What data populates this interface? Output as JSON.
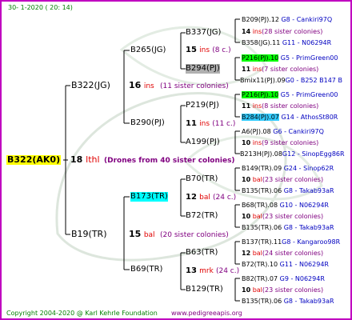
{
  "header": {
    "date_text": "30-   1-2020  ( 20:  14)"
  },
  "footer": {
    "copyright": "Copyright 2004-2020 @ Karl Kehrle Foundation",
    "site": "www.pedigreeapis.org"
  },
  "root": {
    "label": "B322(AK0)",
    "index": "18",
    "ins": "lthl",
    "note": "(Drones from 40 sister colonies)"
  },
  "gen1": [
    {
      "label": "B322(JG)",
      "index": "16",
      "ins": "ins",
      "note": "(11 sister colonies)"
    },
    {
      "label": "B19(TR)",
      "index": "15",
      "ins": "bal",
      "note": "(20 sister colonies)"
    }
  ],
  "gen2": [
    {
      "label": "B265(JG)",
      "index": "15",
      "ins": "ins",
      "note": "(8 c.)"
    },
    {
      "label": "B290(PJ)",
      "index": "13",
      "ins": "ins",
      "note": "(11 c.)"
    },
    {
      "label": "B173(TR)",
      "index": "12",
      "ins": "bal",
      "note": "(24 c.)"
    },
    {
      "label": "B69(TR)",
      "index": "13",
      "ins": "mrk",
      "note": "(24 c.)"
    }
  ],
  "gen3": [
    {
      "label": "B337(JG)",
      "index": "15",
      "ins": "ins",
      "note": "(8 c.)"
    },
    {
      "label": "B294(PJ)"
    },
    {
      "label": "P219(PJ)",
      "index": "11",
      "ins": "ins",
      "note": "(11 c.)"
    },
    {
      "label": "A199(PJ)"
    },
    {
      "label": "B70(TR)",
      "index": "12",
      "ins": "bal",
      "note": "(24 c.)"
    },
    {
      "label": "B72(TR)"
    },
    {
      "label": "B63(TR)",
      "index": "13",
      "ins": "mrk",
      "note": "(24 c.)"
    },
    {
      "label": "B129(TR)"
    }
  ],
  "gen4": [
    {
      "label": "B209(PJ).12",
      "suffix": "G8 - Cankiri97Q"
    },
    {
      "label": "14",
      "ins": "ins",
      "note": "(28 sister colonies)"
    },
    {
      "label": "B358(JG).11",
      "suffix": "G11 - N06294R"
    },
    {
      "label": "P216(PJ).10",
      "suffix": "G5 - PrimGreen00"
    },
    {
      "label": "11",
      "ins": "ins",
      "note": "(7 sister colonies)"
    },
    {
      "label": "Bmix11(PJ).09",
      "suffix": "G0 - B252 B147 B"
    },
    {
      "label": "P216(PJ).10",
      "suffix": "G5 - PrimGreen00"
    },
    {
      "label": "11",
      "ins": "ins",
      "note": "(8 sister colonies)"
    },
    {
      "label": "B284(PJ).07",
      "suffix": "G14 - AthosSt80R"
    },
    {
      "label": "A6(PJ).08",
      "suffix": "G6 - Cankiri97Q"
    },
    {
      "label": "10",
      "ins": "ins",
      "note": "(9 sister colonies)"
    },
    {
      "label": "B213H(PJ).08",
      "suffix": "G12 - SinopEgg86R"
    },
    {
      "label": "B149(TR).09",
      "suffix": "G24 - Sinop62R"
    },
    {
      "label": "10",
      "ins": "bal",
      "note": "(23 sister colonies)"
    },
    {
      "label": "B135(TR).06",
      "suffix": "G8 - Takab93aR"
    },
    {
      "label": "B68(TR).08",
      "suffix": "G10 - N06294R"
    },
    {
      "label": "10",
      "ins": "bal",
      "note": "(23 sister colonies)"
    },
    {
      "label": "B135(TR).06",
      "suffix": "G8 - Takab93aR"
    },
    {
      "label": "B137(TR).11",
      "suffix": "G8 - Kangaroo98R"
    },
    {
      "label": "12",
      "ins": "bal",
      "note": "(24 sister colonies)"
    },
    {
      "label": "B72(TR).10",
      "suffix": "G11 - N06294R"
    },
    {
      "label": "B82(TR).07",
      "suffix": "G9 - N06294R"
    },
    {
      "label": "10",
      "ins": "bal",
      "note": "(23 sister colonies)"
    },
    {
      "label": "B135(TR).06",
      "suffix": "G8 - Takab93aR"
    }
  ]
}
